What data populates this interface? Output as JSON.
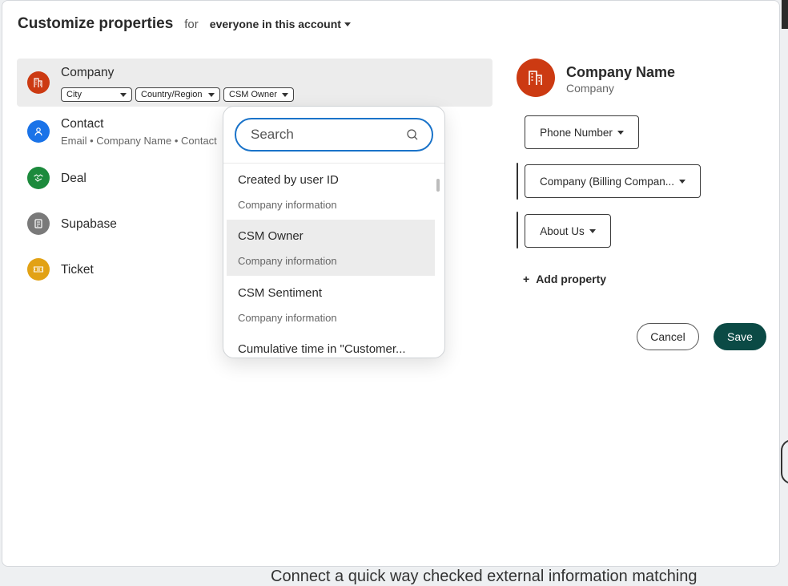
{
  "header": {
    "title": "Customize properties",
    "for_text": "for",
    "scope": "everyone in this account"
  },
  "objects": [
    {
      "label": "Company",
      "icon": "building-icon",
      "color": "#cc3a12",
      "chips": [
        "City",
        "Country/Region",
        "CSM Owner"
      ]
    },
    {
      "label": "Contact",
      "icon": "person-icon",
      "color": "#1a73e8",
      "sub": "Email • Company Name • Contact"
    },
    {
      "label": "Deal",
      "icon": "handshake-icon",
      "color": "#1c8a3c"
    },
    {
      "label": "Supabase",
      "icon": "object-icon",
      "color": "#7a7a7a"
    },
    {
      "label": "Ticket",
      "icon": "ticket-icon",
      "color": "#e2a215"
    }
  ],
  "dropdown": {
    "search_placeholder": "Search",
    "results": [
      {
        "title": "Created by user ID",
        "group": "Company information"
      },
      {
        "title": "CSM Owner",
        "group": "Company information"
      },
      {
        "title": "CSM Sentiment",
        "group": "Company information"
      },
      {
        "title": "Cumulative time in \"Customer...",
        "group": ""
      }
    ]
  },
  "preview": {
    "name": "Company Name",
    "type": "Company",
    "properties": [
      "Phone Number",
      "Company (Billing Compan...",
      "About Us"
    ]
  },
  "actions": {
    "add_property": "Add property",
    "cancel": "Cancel",
    "save": "Save"
  },
  "background": {
    "partial_text": "Connect a quick way checked external information matching"
  },
  "colors": {
    "accent": "#1a73c9",
    "save": "#0b4a45",
    "company": "#cc3a12"
  }
}
